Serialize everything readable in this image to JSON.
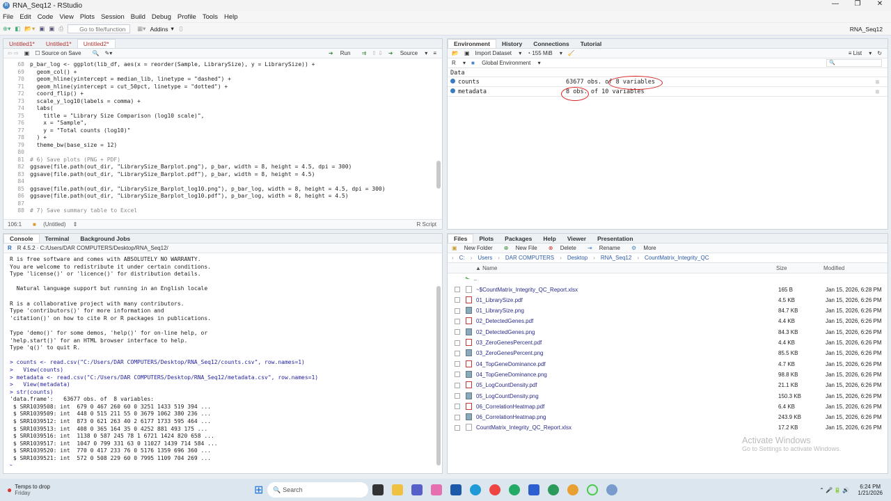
{
  "window": {
    "title": "RNA_Seq12 - RStudio",
    "project": "RNA_Seq12"
  },
  "menu": [
    "File",
    "Edit",
    "Code",
    "View",
    "Plots",
    "Session",
    "Build",
    "Debug",
    "Profile",
    "Tools",
    "Help"
  ],
  "toolbar": {
    "goto_placeholder": "Go to file/function",
    "addins": "Addins"
  },
  "editor": {
    "tabs": [
      "Untitled1*",
      "Untitled1*",
      "Untitled2*"
    ],
    "source_on_save": "Source on Save",
    "run": "Run",
    "source": "Source",
    "lines": [
      {
        "n": "68",
        "t": "p_bar_log <- ggplot(lib_df, aes(x = reorder(Sample, LibrarySize), y = LibrarySize)) +"
      },
      {
        "n": "69",
        "t": "  geom_col() +"
      },
      {
        "n": "70",
        "t": "  geom_hline(yintercept = median_lib, linetype = \"dashed\") +"
      },
      {
        "n": "71",
        "t": "  geom_hline(yintercept = cut_50pct, linetype = \"dotted\") +"
      },
      {
        "n": "72",
        "t": "  coord_flip() +"
      },
      {
        "n": "73",
        "t": "  scale_y_log10(labels = comma) +"
      },
      {
        "n": "74",
        "t": "  labs("
      },
      {
        "n": "75",
        "t": "    title = \"Library Size Comparison (log10 scale)\","
      },
      {
        "n": "76",
        "t": "    x = \"Sample\","
      },
      {
        "n": "77",
        "t": "    y = \"Total counts (log10)\""
      },
      {
        "n": "78",
        "t": "  ) +"
      },
      {
        "n": "79",
        "t": "  theme_bw(base_size = 12)"
      },
      {
        "n": "80",
        "t": ""
      },
      {
        "n": "81",
        "t": "# 6) Save plots (PNG + PDF)",
        "c": true
      },
      {
        "n": "82",
        "t": "ggsave(file.path(out_dir, \"LibrarySize_Barplot.png\"), p_bar, width = 8, height = 4.5, dpi = 300)"
      },
      {
        "n": "83",
        "t": "ggsave(file.path(out_dir, \"LibrarySize_Barplot.pdf\"), p_bar, width = 8, height = 4.5)"
      },
      {
        "n": "84",
        "t": ""
      },
      {
        "n": "85",
        "t": "ggsave(file.path(out_dir, \"LibrarySize_Barplot_log10.png\"), p_bar_log, width = 8, height = 4.5, dpi = 300)"
      },
      {
        "n": "86",
        "t": "ggsave(file.path(out_dir, \"LibrarySize_Barplot_log10.pdf\"), p_bar_log, width = 8, height = 4.5)"
      },
      {
        "n": "87",
        "t": ""
      },
      {
        "n": "88",
        "t": "# 7) Save summary table to Excel",
        "c": true
      }
    ],
    "status_pos": "106:1",
    "status_scope": "(Untitled)",
    "status_type": "R Script"
  },
  "environment": {
    "tabs": [
      "Environment",
      "History",
      "Connections",
      "Tutorial"
    ],
    "import": "Import Dataset",
    "memory": "155 MiB",
    "lang": "R",
    "scope": "Global Environment",
    "view": "List",
    "section": "Data",
    "rows": [
      {
        "name": "counts",
        "value": "63677 obs. of 8 variables"
      },
      {
        "name": "metadata",
        "value": "8 obs. of 10 variables"
      }
    ]
  },
  "console": {
    "tabs": [
      "Console",
      "Terminal",
      "Background Jobs"
    ],
    "path": "R 4.5.2 · C:/Users/DAR COMPUTERS/Desktop/RNA_Seq12/",
    "lines": [
      {
        "t": "R is free software and comes with ABSOLUTELY NO WARRANTY."
      },
      {
        "t": "You are welcome to redistribute it under certain conditions."
      },
      {
        "t": "Type 'license()' or 'licence()' for distribution details."
      },
      {
        "t": ""
      },
      {
        "t": "  Natural language support but running in an English locale"
      },
      {
        "t": ""
      },
      {
        "t": "R is a collaborative project with many contributors."
      },
      {
        "t": "Type 'contributors()' for more information and"
      },
      {
        "t": "'citation()' on how to cite R or R packages in publications."
      },
      {
        "t": ""
      },
      {
        "t": "Type 'demo()' for some demos, 'help()' for on-line help, or"
      },
      {
        "t": "'help.start()' for an HTML browser interface to help."
      },
      {
        "t": "Type 'q()' to quit R."
      },
      {
        "t": ""
      },
      {
        "t": "> counts <- read.csv(\"C:/Users/DAR COMPUTERS/Desktop/RNA_Seq12/counts.csv\", row.names=1)",
        "cmd": true
      },
      {
        "t": ">   View(counts)",
        "cmd": true
      },
      {
        "t": "> metadata <- read.csv(\"C:/Users/DAR COMPUTERS/Desktop/RNA_Seq12/metadata.csv\", row.names=1)",
        "cmd": true
      },
      {
        "t": ">   View(metadata)",
        "cmd": true
      },
      {
        "t": "> str(counts)",
        "cmd": true
      },
      {
        "t": "'data.frame':   63677 obs. of  8 variables:"
      },
      {
        "t": " $ SRR1039508: int  679 0 467 260 60 0 3251 1433 519 394 ..."
      },
      {
        "t": " $ SRR1039509: int  448 0 515 211 55 0 3679 1062 380 236 ..."
      },
      {
        "t": " $ SRR1039512: int  873 0 621 263 40 2 6177 1733 595 464 ..."
      },
      {
        "t": " $ SRR1039513: int  408 0 365 164 35 0 4252 881 493 175 ..."
      },
      {
        "t": " $ SRR1039516: int  1138 0 587 245 78 1 6721 1424 820 658 ..."
      },
      {
        "t": " $ SRR1039517: int  1047 0 799 331 63 0 11027 1439 714 584 ..."
      },
      {
        "t": " $ SRR1039520: int  770 0 417 233 76 0 5176 1359 696 360 ..."
      },
      {
        "t": " $ SRR1039521: int  572 0 508 229 60 0 7995 1109 704 269 ..."
      },
      {
        "t": "> ",
        "cmd": true
      }
    ]
  },
  "files": {
    "tabs": [
      "Files",
      "Plots",
      "Packages",
      "Help",
      "Viewer",
      "Presentation"
    ],
    "actions": [
      "New Folder",
      "New File",
      "Delete",
      "Rename",
      "More"
    ],
    "breadcrumb": [
      "C:",
      "Users",
      "DAR COMPUTERS",
      "Desktop",
      "RNA_Seq12",
      "CountMatrix_Integrity_QC"
    ],
    "headers": {
      "name": "Name",
      "size": "Size",
      "modified": "Modified"
    },
    "parent": "..",
    "rows": [
      {
        "name": "~$CountMatrix_Integrity_QC_Report.xlsx",
        "size": "165 B",
        "modified": "Jan 15, 2026, 6:28 PM",
        "type": "doc"
      },
      {
        "name": "01_LibrarySize.pdf",
        "size": "4.5 KB",
        "modified": "Jan 15, 2026, 6:26 PM",
        "type": "pdf"
      },
      {
        "name": "01_LibrarySize.png",
        "size": "84.7 KB",
        "modified": "Jan 15, 2026, 6:26 PM",
        "type": "png"
      },
      {
        "name": "02_DetectedGenes.pdf",
        "size": "4.4 KB",
        "modified": "Jan 15, 2026, 6:26 PM",
        "type": "pdf"
      },
      {
        "name": "02_DetectedGenes.png",
        "size": "84.3 KB",
        "modified": "Jan 15, 2026, 6:26 PM",
        "type": "png"
      },
      {
        "name": "03_ZeroGenesPercent.pdf",
        "size": "4.4 KB",
        "modified": "Jan 15, 2026, 6:26 PM",
        "type": "pdf"
      },
      {
        "name": "03_ZeroGenesPercent.png",
        "size": "85.5 KB",
        "modified": "Jan 15, 2026, 6:26 PM",
        "type": "png"
      },
      {
        "name": "04_TopGeneDominance.pdf",
        "size": "4.7 KB",
        "modified": "Jan 15, 2026, 6:26 PM",
        "type": "pdf"
      },
      {
        "name": "04_TopGeneDominance.png",
        "size": "98.8 KB",
        "modified": "Jan 15, 2026, 6:26 PM",
        "type": "png"
      },
      {
        "name": "05_LogCountDensity.pdf",
        "size": "21.1 KB",
        "modified": "Jan 15, 2026, 6:26 PM",
        "type": "pdf"
      },
      {
        "name": "05_LogCountDensity.png",
        "size": "150.3 KB",
        "modified": "Jan 15, 2026, 6:26 PM",
        "type": "png"
      },
      {
        "name": "06_CorrelationHeatmap.pdf",
        "size": "6.4 KB",
        "modified": "Jan 15, 2026, 6:26 PM",
        "type": "pdf"
      },
      {
        "name": "06_CorrelationHeatmap.png",
        "size": "243.9 KB",
        "modified": "Jan 15, 2026, 6:26 PM",
        "type": "png"
      },
      {
        "name": "CountMatrix_Integrity_QC_Report.xlsx",
        "size": "17.2 KB",
        "modified": "Jan 15, 2026, 6:26 PM",
        "type": "doc"
      }
    ]
  },
  "watermark": {
    "title": "Activate Windows",
    "sub": "Go to Settings to activate Windows."
  },
  "taskbar": {
    "weather": "Temps to drop",
    "day": "Friday",
    "search": "Search",
    "time": "6:24 PM",
    "date": "1/21/2026"
  }
}
